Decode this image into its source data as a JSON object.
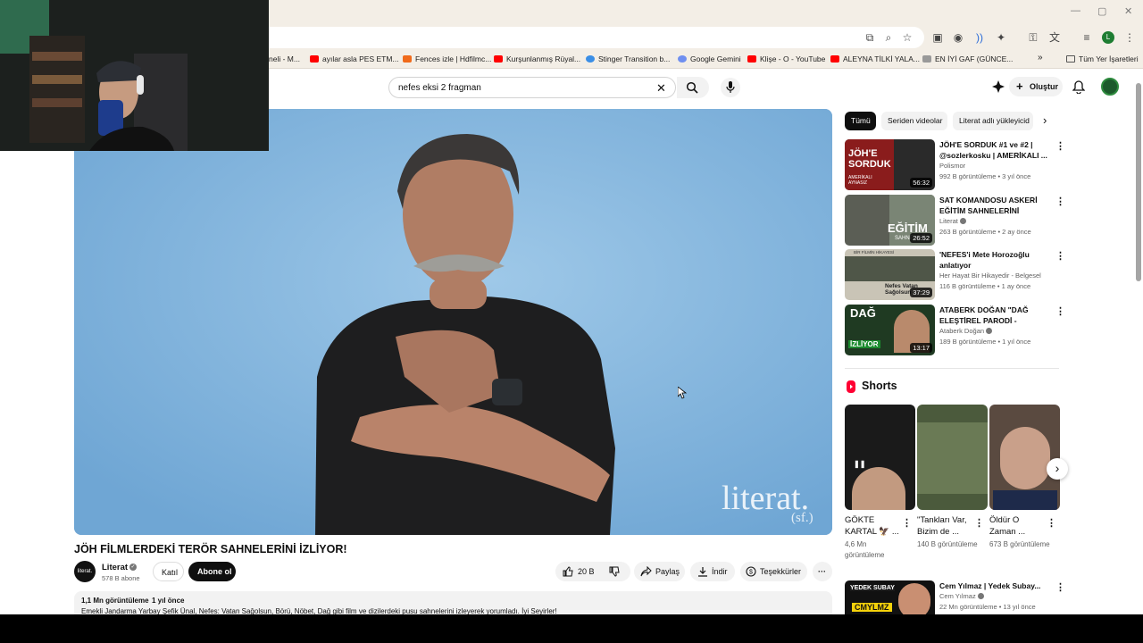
{
  "bookmarks": {
    "items": [
      "neli - M...",
      "ayılar asla PES ETM...",
      "Fences izle | Hdfilmc...",
      "Kurşunlanmış Rüyal...",
      "Stinger Transition b...",
      "Google Gemini",
      "Klişe - O - YouTube",
      "ALEYNA TİLKİ YALA...",
      "EN İYİ GAF (GÜNCE..."
    ],
    "more": "»",
    "all_bookmarks": "Tüm Yer İşaretleri"
  },
  "header": {
    "search_value": "nefes eksi 2 fragman",
    "create_label": "Oluştur"
  },
  "video": {
    "watermark": "literat.",
    "watermark_sub": "(sf.)",
    "title": "JÖH FİLMLERDEKİ TERÖR SAHNELERİNİ İZLİYOR!",
    "channel": "Literat",
    "channel_avatar": "literat.",
    "subscribers": "578 B abone",
    "join": "Katıl",
    "subscribe": "Abone ol",
    "likes": "20 B",
    "share": "Paylaş",
    "download": "İndir",
    "thanks": "Teşekkürler",
    "views": "1,1 Mn görüntüleme",
    "date": "1 yıl önce",
    "description": "Emekli Jandarma Yarbay Şefik Ünal, Nefes: Vatan Sağolsun, Börü, Nöbet, Dağ gibi film ve dizilerdeki pusu sahnelerini izleyerek yorumladı. İyi Seyirler!"
  },
  "chips": [
    "Tümü",
    "Seriden videolar",
    "Literat adlı yükleyicid"
  ],
  "recs": [
    {
      "title": "JÖH'E SORDUK #1 ve #2 | @sozlerkosku | AMERİKALI ...",
      "channel": "Polismor",
      "meta": "992 B görüntüleme • 3 yıl önce",
      "duration": "56:32",
      "thumb_text": "JÖH'E SORDUK",
      "thumb_sub": "AMERİKALI AYNASIZ"
    },
    {
      "title": "SAT KOMANDOSU ASKERİ EĞİTİM SAHNELERİNİ İZLİYOR!",
      "channel": "Literat",
      "meta": "263 B görüntüleme • 2 ay önce",
      "duration": "26:52",
      "thumb_text": "EĞİTİM",
      "thumb_sub": "SAHNELERİ"
    },
    {
      "title": "'NEFES'i Mete Horozoğlu anlatıyor",
      "channel": "Her Hayat Bir Hikayedir - Belgesel",
      "meta": "116 B görüntüleme • 1 ay önce",
      "duration": "37:29",
      "thumb_text": "BİR FİLMİN HİKAYESİ",
      "thumb_sub": "Nefes Vatan Sağolsun"
    },
    {
      "title": "ATABERK DOĞAN \"DAĞ ELEŞTİREL PARODİ - FİLMLER ...",
      "channel": "Ataberk Doğan",
      "meta": "189 B görüntüleme • 1 yıl önce",
      "duration": "13:17",
      "thumb_text": "DAĞ",
      "thumb_sub": "İZLİYOR"
    }
  ],
  "shorts": {
    "heading": "Shorts",
    "items": [
      {
        "title": "GÖKTE KARTAL 🦅 ...",
        "views": "4,6 Mn görüntüleme"
      },
      {
        "title": "\"Tankları Var, Bizim de ...",
        "views": "140 B görüntüleme"
      },
      {
        "title": "Öldür O Zaman ...",
        "views": "673 B görüntüleme"
      }
    ]
  },
  "bottom_rec": {
    "title": "Cem Yılmaz | Yedek Subay...",
    "channel": "Cem Yılmaz",
    "meta": "22 Mn görüntüleme • 13 yıl önce",
    "thumb_text": "YEDEK SUBAY",
    "thumb_sub": "CMYLMZ"
  }
}
